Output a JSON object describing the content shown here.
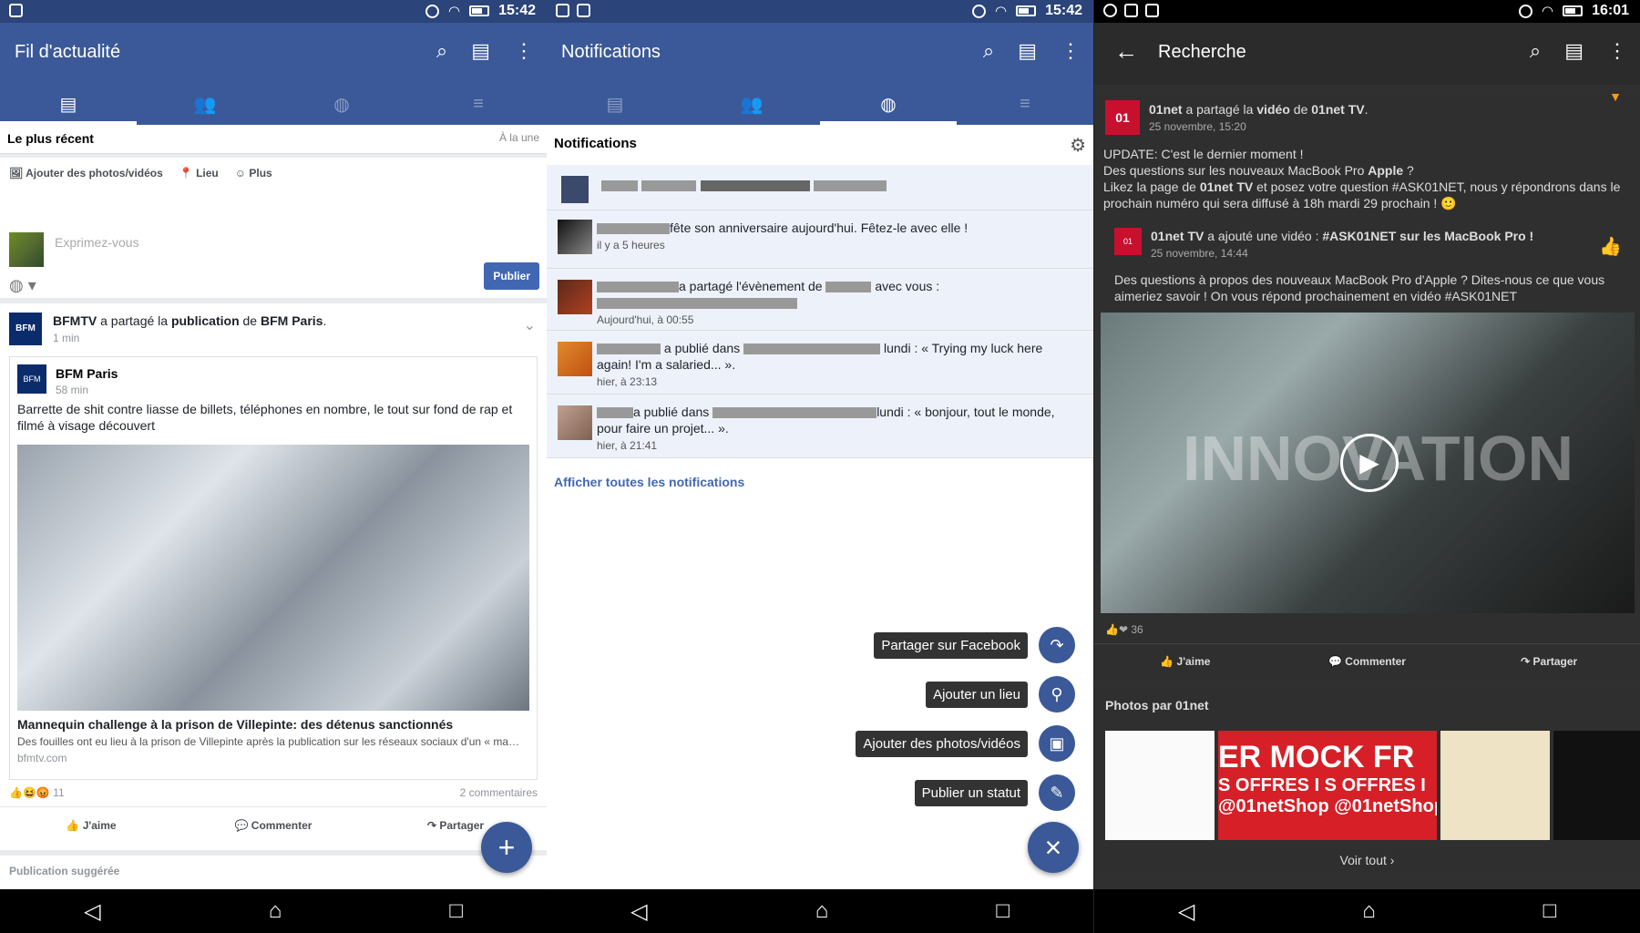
{
  "screen1": {
    "status_time": "15:42",
    "title": "Fil d'actualité",
    "sort_label": "Le plus récent",
    "sort_right": "À la une",
    "composer": {
      "photos": "Ajouter des photos/vidéos",
      "place": "Lieu",
      "more": "Plus",
      "placeholder": "Exprimez-vous",
      "publish": "Publier"
    },
    "post": {
      "author": "BFMTV",
      "shared": "a partagé la",
      "pub": "publication",
      "of": "de",
      "source": "BFM Paris",
      "time": "1 min",
      "inner_author": "BFM Paris",
      "inner_time": "58 min",
      "text": "Barrette de shit contre liasse de billets, téléphones en nombre, le tout sur fond de rap et filmé à visage découvert",
      "link_title": "Mannequin challenge à la prison de Villepinte: des détenus sanctionnés",
      "link_desc": "Des fouilles ont eu lieu à la prison de Villepinte après la publication sur les réseaux sociaux d'un « ma…",
      "link_domain": "bfmtv.com",
      "reactions": "11",
      "comments": "2 commentaires",
      "like": "J'aime",
      "comment": "Commenter",
      "share": "Partager"
    },
    "suggested": "Publication suggérée"
  },
  "screen2": {
    "status_time": "15:42",
    "title": "Notifications",
    "section": "Notifications",
    "items": [
      {
        "text": "fête son anniversaire aujourd'hui. Fêtez-le avec elle !",
        "time": "il y a 5 heures"
      },
      {
        "text": "a partagé l'évènement de",
        "text2": "avec vous :",
        "time": "Aujourd'hui, à 00:55"
      },
      {
        "text": "a publié dans",
        "text2": "lundi : « Trying my luck here again! I'm a salaried... ».",
        "time": "hier, à 23:13"
      },
      {
        "text": "a publié dans",
        "text2": "lundi : « bonjour, tout le monde, pour faire un projet... ».",
        "time": "hier, à 21:41"
      }
    ],
    "see_all": "Afficher toutes les notifications",
    "menu": [
      "Partager sur Facebook",
      "Ajouter un lieu",
      "Ajouter des photos/vidéos",
      "Publier un statut"
    ],
    "close": "×"
  },
  "screen3": {
    "status_time": "16:01",
    "title": "Recherche",
    "post": {
      "author": "01net",
      "shared": "a partagé la",
      "video": "vidéo",
      "of": "de",
      "source": "01net TV",
      ".": ".",
      "date": "25 novembre, 15:20",
      "text1": "UPDATE: C'est le dernier moment !",
      "text2": "Des questions sur les nouveaux MacBook Pro",
      "text2b": "Apple",
      "text3": "Likez la page de",
      "text3b": "01net TV",
      "text3c": "et posez votre question #ASK01NET, nous y répondrons dans le prochain numéro qui sera diffusé à 18h mardi 29 prochain ! 🙂",
      "inner_author": "01net TV",
      "inner_action": "a ajouté une vidéo :",
      "inner_title": "#ASK01NET sur les MacBook Pro !",
      "inner_date": "25 novembre, 14:44",
      "inner_text": "Des questions à propos des nouveaux MacBook Pro d'Apple ? Dites-nous ce que vous aimeriez savoir ! On vous répond prochainement en vidéo #ASK01NET",
      "video_text": "INNOVATION",
      "reactions": "36",
      "like": "J'aime",
      "comment": "Commenter",
      "share": "Partager"
    },
    "photos_title": "Photos par 01net",
    "promo1": "ER MOCK FR",
    "promo2": "S OFFRES I S OFFRES I",
    "promo3": "@01netShop @01netShop",
    "see_all": "Voir tout"
  }
}
